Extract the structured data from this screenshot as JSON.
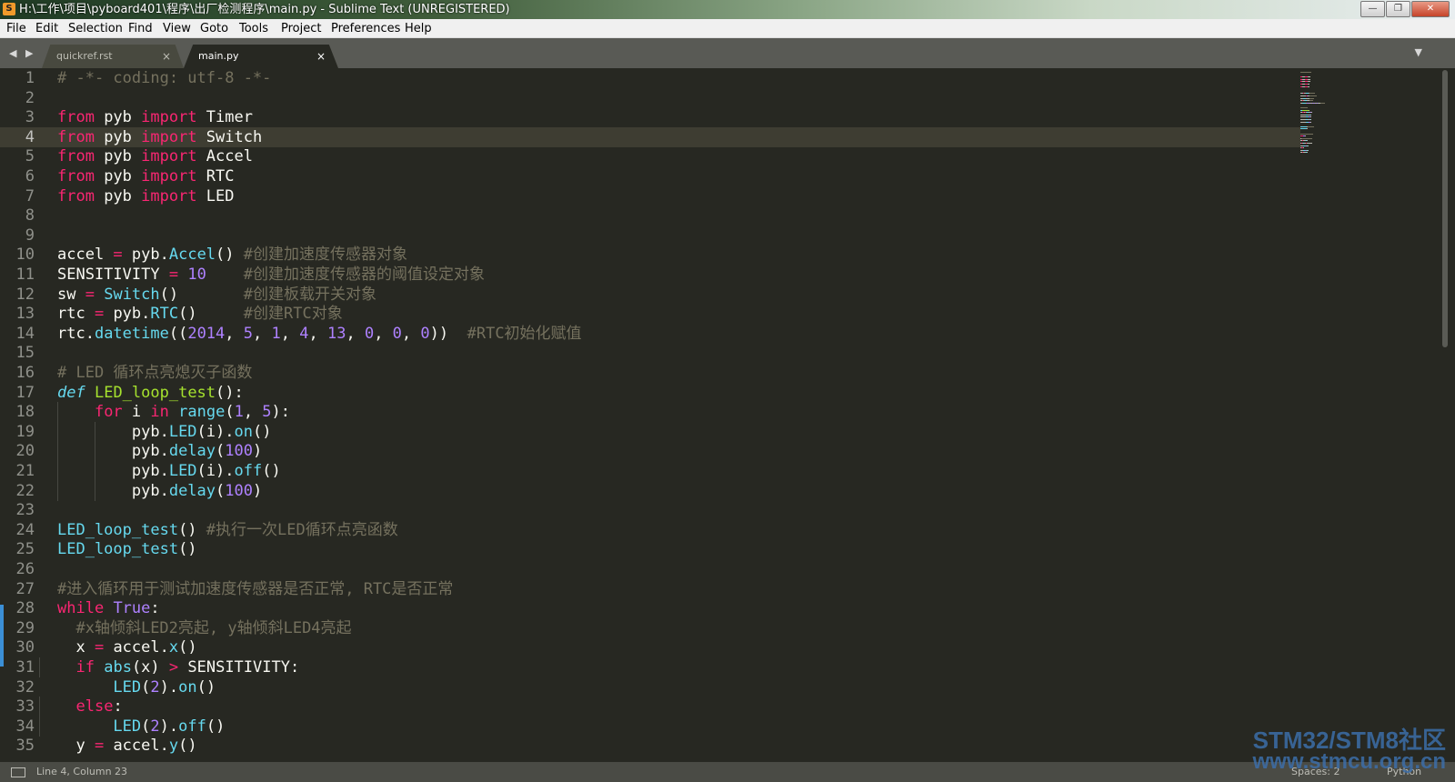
{
  "window": {
    "title": "H:\\工作\\项目\\pyboard401\\程序\\出厂检测程序\\main.py - Sublime Text (UNREGISTERED)",
    "app_icon": "sublime-text-icon",
    "buttons": {
      "minimize": "—",
      "restore": "❐",
      "close": "✕"
    }
  },
  "menu": {
    "items": [
      "File",
      "Edit",
      "Selection",
      "Find",
      "View",
      "Goto",
      "Tools",
      "Project",
      "Preferences",
      "Help"
    ]
  },
  "tabs": {
    "nav_arrows": "◀ ▶",
    "items": [
      {
        "label": "quickref.rst",
        "close": "×",
        "active": false
      },
      {
        "label": "main.py",
        "close": "×",
        "active": true
      }
    ],
    "dropdown": "▼"
  },
  "editor": {
    "current_line": 4,
    "line_numbers": [
      "1",
      "2",
      "3",
      "4",
      "5",
      "6",
      "7",
      "8",
      "9",
      "10",
      "11",
      "12",
      "13",
      "14",
      "15",
      "16",
      "17",
      "18",
      "19",
      "20",
      "21",
      "22",
      "23",
      "24",
      "25",
      "26",
      "27",
      "28",
      "29",
      "30",
      "31",
      "32",
      "33",
      "34",
      "35"
    ],
    "lines": [
      [
        [
          "c",
          "# -*- coding: utf-8 -*-"
        ]
      ],
      [],
      [
        [
          "k",
          "from"
        ],
        [
          "t",
          " pyb "
        ],
        [
          "k",
          "import"
        ],
        [
          "t",
          " Timer"
        ]
      ],
      [
        [
          "k",
          "from"
        ],
        [
          "t",
          " pyb "
        ],
        [
          "k",
          "import"
        ],
        [
          "t",
          " Switch"
        ]
      ],
      [
        [
          "k",
          "from"
        ],
        [
          "t",
          " pyb "
        ],
        [
          "k",
          "import"
        ],
        [
          "t",
          " Accel"
        ]
      ],
      [
        [
          "k",
          "from"
        ],
        [
          "t",
          " pyb "
        ],
        [
          "k",
          "import"
        ],
        [
          "t",
          " RTC"
        ]
      ],
      [
        [
          "k",
          "from"
        ],
        [
          "t",
          " pyb "
        ],
        [
          "k",
          "import"
        ],
        [
          "t",
          " LED"
        ]
      ],
      [],
      [],
      [
        [
          "t",
          "accel "
        ],
        [
          "k",
          "="
        ],
        [
          "t",
          " pyb."
        ],
        [
          "f",
          "Accel"
        ],
        [
          "t",
          "() "
        ],
        [
          "c",
          "#创建加速度传感器对象"
        ]
      ],
      [
        [
          "t",
          "SENSITIVITY "
        ],
        [
          "k",
          "="
        ],
        [
          "t",
          " "
        ],
        [
          "n",
          "10"
        ],
        [
          "t",
          "    "
        ],
        [
          "c",
          "#创建加速度传感器的阈值设定对象"
        ]
      ],
      [
        [
          "t",
          "sw "
        ],
        [
          "k",
          "="
        ],
        [
          "t",
          " "
        ],
        [
          "f",
          "Switch"
        ],
        [
          "t",
          "()       "
        ],
        [
          "c",
          "#创建板载开关对象"
        ]
      ],
      [
        [
          "t",
          "rtc "
        ],
        [
          "k",
          "="
        ],
        [
          "t",
          " pyb."
        ],
        [
          "f",
          "RTC"
        ],
        [
          "t",
          "()     "
        ],
        [
          "c",
          "#创建RTC对象"
        ]
      ],
      [
        [
          "t",
          "rtc."
        ],
        [
          "f",
          "datetime"
        ],
        [
          "t",
          "(("
        ],
        [
          "n",
          "2014"
        ],
        [
          "t",
          ", "
        ],
        [
          "n",
          "5"
        ],
        [
          "t",
          ", "
        ],
        [
          "n",
          "1"
        ],
        [
          "t",
          ", "
        ],
        [
          "n",
          "4"
        ],
        [
          "t",
          ", "
        ],
        [
          "n",
          "13"
        ],
        [
          "t",
          ", "
        ],
        [
          "n",
          "0"
        ],
        [
          "t",
          ", "
        ],
        [
          "n",
          "0"
        ],
        [
          "t",
          ", "
        ],
        [
          "n",
          "0"
        ],
        [
          "t",
          "))  "
        ],
        [
          "c",
          "#RTC初始化赋值"
        ]
      ],
      [],
      [
        [
          "c",
          "# LED 循环点亮熄灭子函数"
        ]
      ],
      [
        [
          "i",
          "def"
        ],
        [
          "t",
          " "
        ],
        [
          "d",
          "LED_loop_test"
        ],
        [
          "t",
          "():"
        ]
      ],
      [
        [
          "t",
          "    "
        ],
        [
          "k",
          "for"
        ],
        [
          "t",
          " i "
        ],
        [
          "k",
          "in"
        ],
        [
          "t",
          " "
        ],
        [
          "f",
          "range"
        ],
        [
          "t",
          "("
        ],
        [
          "n",
          "1"
        ],
        [
          "t",
          ", "
        ],
        [
          "n",
          "5"
        ],
        [
          "t",
          "):"
        ]
      ],
      [
        [
          "t",
          "        pyb."
        ],
        [
          "f",
          "LED"
        ],
        [
          "t",
          "(i)."
        ],
        [
          "f",
          "on"
        ],
        [
          "t",
          "()"
        ]
      ],
      [
        [
          "t",
          "        pyb."
        ],
        [
          "f",
          "delay"
        ],
        [
          "t",
          "("
        ],
        [
          "n",
          "100"
        ],
        [
          "t",
          ")"
        ]
      ],
      [
        [
          "t",
          "        pyb."
        ],
        [
          "f",
          "LED"
        ],
        [
          "t",
          "(i)."
        ],
        [
          "f",
          "off"
        ],
        [
          "t",
          "()"
        ]
      ],
      [
        [
          "t",
          "        pyb."
        ],
        [
          "f",
          "delay"
        ],
        [
          "t",
          "("
        ],
        [
          "n",
          "100"
        ],
        [
          "t",
          ")"
        ]
      ],
      [],
      [
        [
          "f",
          "LED_loop_test"
        ],
        [
          "t",
          "() "
        ],
        [
          "c",
          "#执行一次LED循环点亮函数"
        ]
      ],
      [
        [
          "f",
          "LED_loop_test"
        ],
        [
          "t",
          "()"
        ]
      ],
      [],
      [
        [
          "c",
          "#进入循环用于测试加速度传感器是否正常, RTC是否正常"
        ]
      ],
      [
        [
          "k",
          "while"
        ],
        [
          "t",
          " "
        ],
        [
          "n",
          "True"
        ],
        [
          "t",
          ":"
        ]
      ],
      [
        [
          "t",
          "  "
        ],
        [
          "c",
          "#x轴倾斜LED2亮起, y轴倾斜LED4亮起"
        ]
      ],
      [
        [
          "t",
          "  x "
        ],
        [
          "k",
          "="
        ],
        [
          "t",
          " accel."
        ],
        [
          "f",
          "x"
        ],
        [
          "t",
          "()"
        ]
      ],
      [
        [
          "t",
          "  "
        ],
        [
          "k",
          "if"
        ],
        [
          "t",
          " "
        ],
        [
          "f",
          "abs"
        ],
        [
          "t",
          "(x) "
        ],
        [
          "k",
          ">"
        ],
        [
          "t",
          " SENSITIVITY:"
        ]
      ],
      [
        [
          "t",
          "      "
        ],
        [
          "f",
          "LED"
        ],
        [
          "t",
          "("
        ],
        [
          "n",
          "2"
        ],
        [
          "t",
          ")."
        ],
        [
          "f",
          "on"
        ],
        [
          "t",
          "()"
        ]
      ],
      [
        [
          "t",
          "  "
        ],
        [
          "k",
          "else"
        ],
        [
          "t",
          ":"
        ]
      ],
      [
        [
          "t",
          "      "
        ],
        [
          "f",
          "LED"
        ],
        [
          "t",
          "("
        ],
        [
          "n",
          "2"
        ],
        [
          "t",
          ")."
        ],
        [
          "f",
          "off"
        ],
        [
          "t",
          "()"
        ]
      ],
      [
        [
          "t",
          "  y "
        ],
        [
          "k",
          "="
        ],
        [
          "t",
          " accel."
        ],
        [
          "f",
          "y"
        ],
        [
          "t",
          "()"
        ]
      ]
    ]
  },
  "status": {
    "position": "Line 4, Column 23",
    "spaces": "Spaces: 2",
    "syntax": "Python",
    "panel_icon": "panel-toggle-icon"
  },
  "watermark": {
    "line1": "STM32/STM8社区",
    "line2": "www.stmcu.org.cn"
  },
  "colors": {
    "background": "#272822",
    "keyword": "#f92672",
    "function": "#66d9ef",
    "definition": "#a6e22e",
    "number": "#ae81ff",
    "comment": "#75715e",
    "text": "#f8f8f2"
  }
}
